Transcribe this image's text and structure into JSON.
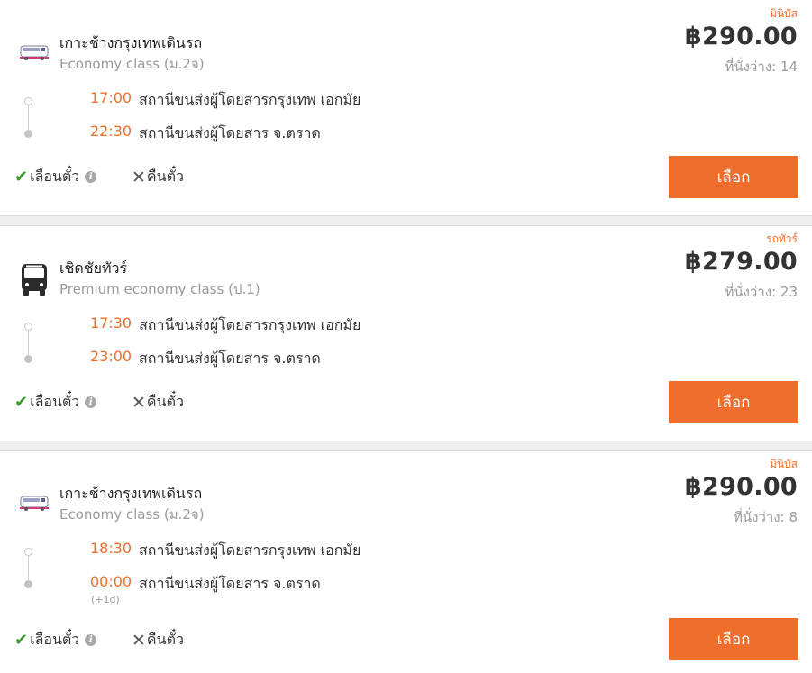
{
  "trips": [
    {
      "tag": "มินิบัส",
      "operator": "เกาะช้างกรุงเทพเดินรถ",
      "class": "Economy class (ม.2จ)",
      "logo": "minibus-company-logo",
      "price": "฿290.00",
      "seats": "ที่นั่งว่าง: 14",
      "depart_time": "17:00",
      "depart_station": "สถานีขนส่งผู้โดยสารกรุงเทพ เอกมัย",
      "arrive_time": "22:30",
      "arrive_station": "สถานีขนส่งผู้โดยสาร จ.ตราด",
      "day_offset": "",
      "reschedule_label": "เลื่อนตั๋ว",
      "refund_label": "คืนตั๋ว",
      "select_label": "เลือก"
    },
    {
      "tag": "รถทัวร์",
      "operator": "เชิดชัยทัวร์",
      "class": "Premium economy class (ป.1)",
      "logo": "bus-icon",
      "price": "฿279.00",
      "seats": "ที่นั่งว่าง: 23",
      "depart_time": "17:30",
      "depart_station": "สถานีขนส่งผู้โดยสารกรุงเทพ เอกมัย",
      "arrive_time": "23:00",
      "arrive_station": "สถานีขนส่งผู้โดยสาร จ.ตราด",
      "day_offset": "",
      "reschedule_label": "เลื่อนตั๋ว",
      "refund_label": "คืนตั๋ว",
      "select_label": "เลือก"
    },
    {
      "tag": "มินิบัส",
      "operator": "เกาะช้างกรุงเทพเดินรถ",
      "class": "Economy class (ม.2จ)",
      "logo": "minibus-company-logo",
      "price": "฿290.00",
      "seats": "ที่นั่งว่าง: 8",
      "depart_time": "18:30",
      "depart_station": "สถานีขนส่งผู้โดยสารกรุงเทพ เอกมัย",
      "arrive_time": "00:00",
      "arrive_station": "สถานีขนส่งผู้โดยสาร จ.ตราด",
      "day_offset": "(+1d)",
      "reschedule_label": "เลื่อนตั๋ว",
      "refund_label": "คืนตั๋ว",
      "select_label": "เลือก"
    }
  ],
  "colors": {
    "accent": "#ee6f2d",
    "check": "#3a9a2e",
    "muted": "#9a9a9a"
  }
}
